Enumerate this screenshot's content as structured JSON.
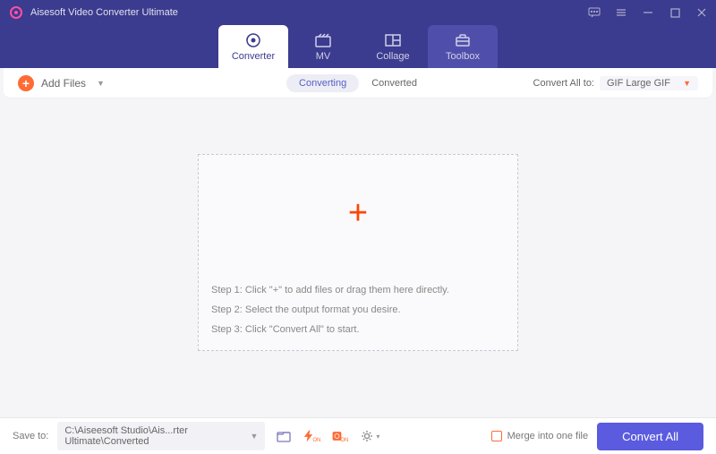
{
  "app": {
    "title": "Aisesoft Video Converter Ultimate"
  },
  "tabs": {
    "converter": "Converter",
    "mv": "MV",
    "collage": "Collage",
    "toolbox": "Toolbox"
  },
  "toolbar": {
    "add_files": "Add Files",
    "converting": "Converting",
    "converted": "Converted",
    "convert_all_to": "Convert All to:",
    "format": "GIF Large GIF"
  },
  "dropzone": {
    "step1": "Step 1: Click \"+\" to add files or drag them here directly.",
    "step2": "Step 2: Select the output format you desire.",
    "step3": "Step 3: Click \"Convert All\" to start."
  },
  "footer": {
    "save_to": "Save to:",
    "path": "C:\\Aiseesoft Studio\\Ais...rter Ultimate\\Converted",
    "merge": "Merge into one file",
    "convert_all": "Convert All"
  }
}
